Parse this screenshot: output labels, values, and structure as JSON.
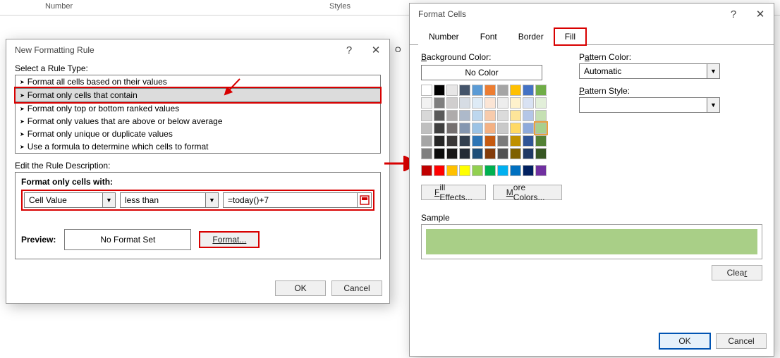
{
  "ribbon": {
    "number": "Number",
    "styles": "Styles",
    "col_o": "O"
  },
  "newRule": {
    "title": "New Formatting Rule",
    "selectLabel": "Select a Rule Type:",
    "types": [
      "Format all cells based on their values",
      "Format only cells that contain",
      "Format only top or bottom ranked values",
      "Format only values that are above or below average",
      "Format only unique or duplicate values",
      "Use a formula to determine which cells to format"
    ],
    "editLabel": "Edit the Rule Description:",
    "conditionLabel": "Format only cells with:",
    "field1": "Cell Value",
    "field2": "less than",
    "formula": "=today()+7",
    "previewLabel": "Preview:",
    "noFormat": "No Format Set",
    "formatBtn": "Format...",
    "ok": "OK",
    "cancel": "Cancel"
  },
  "formatCells": {
    "title": "Format Cells",
    "tabs": [
      "Number",
      "Font",
      "Border",
      "Fill"
    ],
    "bgLabel": "Background Color:",
    "noColor": "No Color",
    "patternColor": "Pattern Color:",
    "automatic": "Automatic",
    "patternStyle": "Pattern Style:",
    "fillEffects": "Fill Effects...",
    "moreColors": "More Colors...",
    "sample": "Sample",
    "clear": "Clear",
    "ok": "OK",
    "cancel": "Cancel",
    "sampleColor": "#a9cf87",
    "themeColors": [
      "#ffffff",
      "#000000",
      "#e7e6e6",
      "#44546a",
      "#5b9bd5",
      "#ed7d31",
      "#a5a5a5",
      "#ffc000",
      "#4472c4",
      "#70ad47",
      "#f2f2f2",
      "#7f7f7f",
      "#d0cece",
      "#d6dce4",
      "#deebf6",
      "#fbe5d5",
      "#ededed",
      "#fff2cc",
      "#d9e2f3",
      "#e2efd9",
      "#d8d8d8",
      "#595959",
      "#aeabab",
      "#adb9ca",
      "#bdd7ee",
      "#f7cbac",
      "#dbdbdb",
      "#fee599",
      "#b4c6e7",
      "#c5e0b3",
      "#bfbfbf",
      "#3f3f3f",
      "#757070",
      "#8496b0",
      "#9cc3e5",
      "#f4b183",
      "#c9c9c9",
      "#ffd965",
      "#8eaadb",
      "#a8d08d",
      "#a5a5a5",
      "#262626",
      "#3a3838",
      "#323f4f",
      "#2e75b5",
      "#c55a11",
      "#7b7b7b",
      "#bf9000",
      "#2f5496",
      "#538135",
      "#7f7f7f",
      "#0c0c0c",
      "#171616",
      "#222a35",
      "#1e4e79",
      "#833c0b",
      "#525252",
      "#7f6000",
      "#1f3864",
      "#375623"
    ],
    "stdColors": [
      "#c00000",
      "#ff0000",
      "#ffc000",
      "#ffff00",
      "#92d050",
      "#00b050",
      "#00b0f0",
      "#0070c0",
      "#002060",
      "#7030a0"
    ]
  }
}
